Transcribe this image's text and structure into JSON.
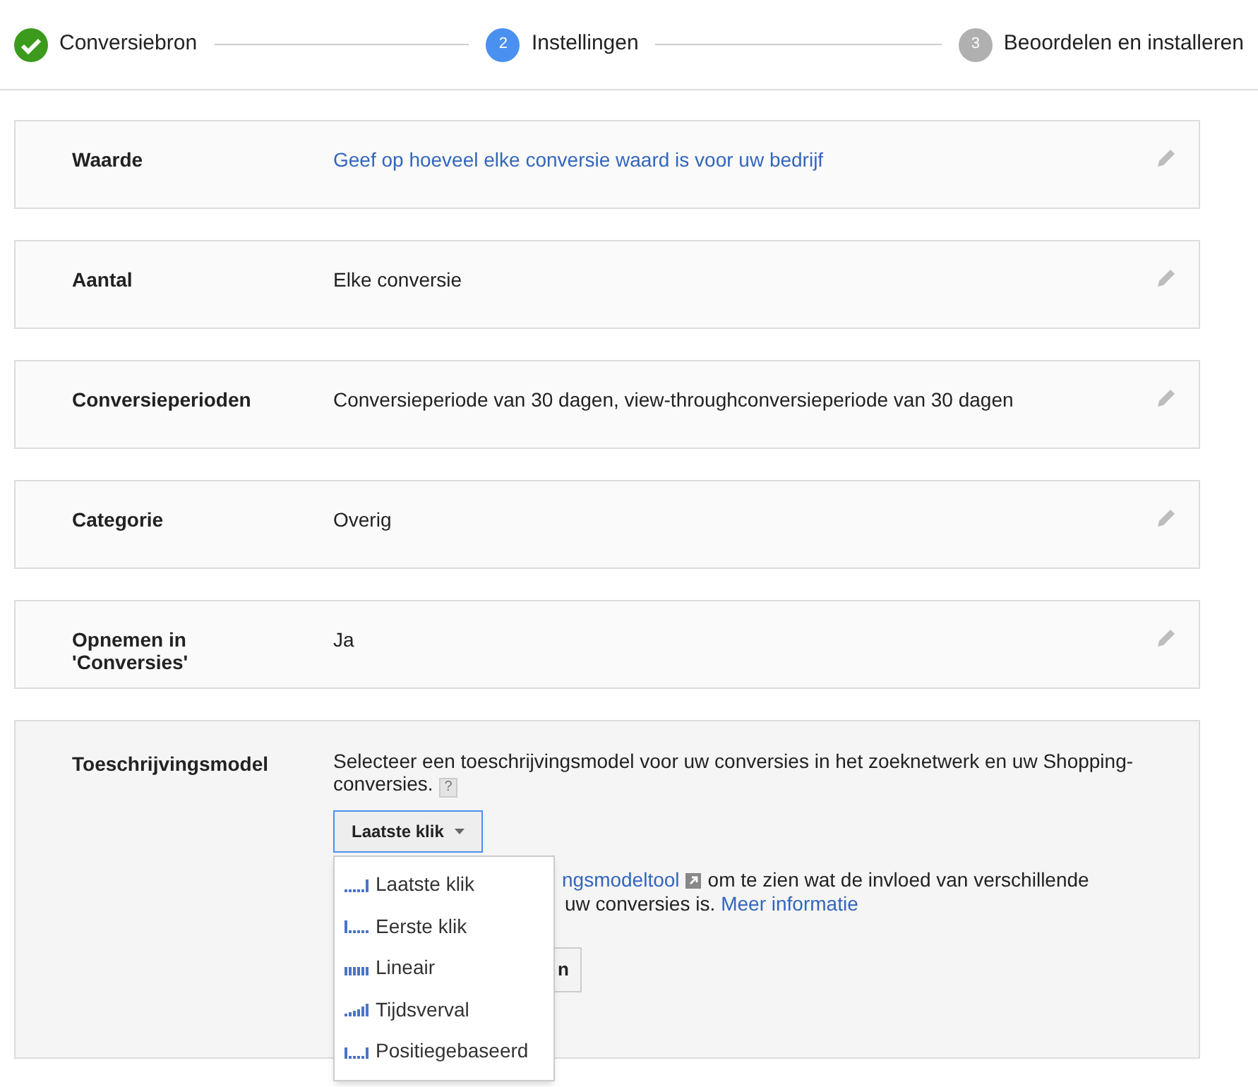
{
  "steps": [
    {
      "label": "Conversiebron",
      "kind": "done"
    },
    {
      "label": "Instellingen",
      "kind": "current",
      "number": "2"
    },
    {
      "label": "Beoordelen en installeren",
      "kind": "todo",
      "number": "3"
    }
  ],
  "settings": [
    {
      "label": "Waarde",
      "value": "Geef op hoeveel elke conversie waard is voor uw bedrijf",
      "kind": "link"
    },
    {
      "label": "Aantal",
      "value": "Elke conversie",
      "kind": "text"
    },
    {
      "label": "Conversieperioden",
      "value": "Conversieperiode van 30 dagen, view-throughconversieperiode van 30 dagen",
      "kind": "text"
    },
    {
      "label": "Categorie",
      "value": "Overig",
      "kind": "text"
    },
    {
      "label": "Opnemen in 'Conversies'",
      "value": "Ja",
      "kind": "text"
    }
  ],
  "attribution": {
    "label": "Toeschrijvingsmodel",
    "description": "Selecteer een toeschrijvingsmodel voor uw conversies in het zoeknetwerk en uw Shopping-conversies.",
    "help": "?",
    "dropdown": "Laatste klik",
    "tool_link": "ngsmodeltool",
    "tool_text": "om te zien wat de invloed van verschillende",
    "line2": "uw conversies is.",
    "more_link": "Meer informatie",
    "button_fragment": "n",
    "menu": [
      {
        "label": "Laatste klik",
        "kind": "last"
      },
      {
        "label": "Eerste klik",
        "kind": "first"
      },
      {
        "label": "Lineair",
        "kind": "linear"
      },
      {
        "label": "Tijdsverval",
        "kind": "decay"
      },
      {
        "label": "Positiegebaseerd",
        "kind": "position"
      }
    ]
  }
}
